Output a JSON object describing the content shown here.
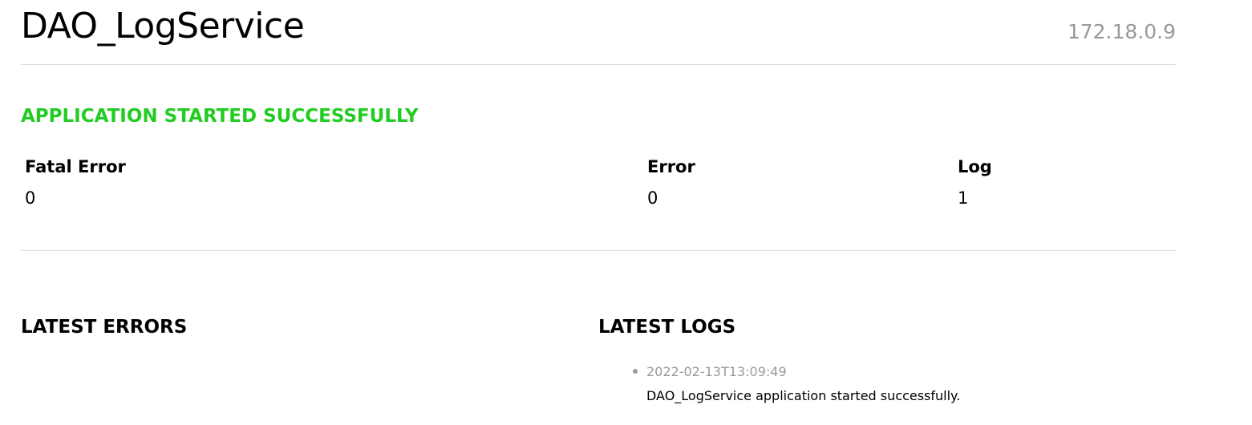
{
  "header": {
    "app_name": "DAO_LogService",
    "host_ip": "172.18.0.9"
  },
  "status": {
    "message": "APPLICATION STARTED SUCCESSFULLY",
    "color": "#22cc22"
  },
  "counters": [
    {
      "label": "Fatal Error",
      "value": "0"
    },
    {
      "label": "Error",
      "value": "0"
    },
    {
      "label": "Log",
      "value": "1"
    }
  ],
  "latest_errors": {
    "title": "LATEST ERRORS",
    "items": []
  },
  "latest_logs": {
    "title": "LATEST LOGS",
    "items": [
      {
        "timestamp": "2022-02-13T13:09:49",
        "message": "DAO_LogService application started successfully."
      }
    ]
  }
}
